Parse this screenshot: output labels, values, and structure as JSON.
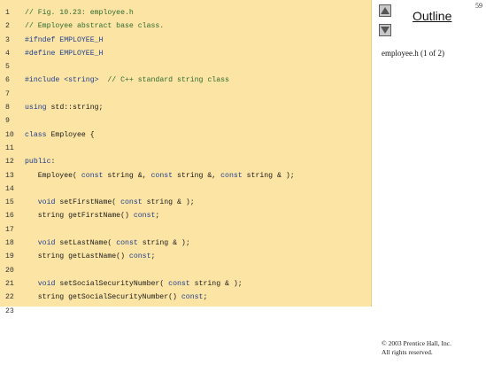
{
  "slide": {
    "number": "59"
  },
  "navigation": {
    "up_icon": "up-arrow-icon",
    "down_icon": "down-arrow-icon",
    "outline_label": "Outline",
    "file_caption": "employee.h (1 of 2)"
  },
  "footer": {
    "copyright_line1": "© 2003 Prentice Hall, Inc.",
    "copyright_line2": "All rights reserved."
  },
  "colors": {
    "code_background": "#fbe4a4",
    "comment": "#2f6b2f",
    "keyword": "#1f3f8f"
  },
  "code": {
    "lines": [
      {
        "num": "1",
        "tokens": [
          {
            "t": "// Fig. 10.23: employee.h",
            "k": "comment"
          }
        ]
      },
      {
        "num": "2",
        "tokens": [
          {
            "t": "// Employee abstract base class.",
            "k": "comment"
          }
        ]
      },
      {
        "num": "3",
        "tokens": [
          {
            "t": "#ifndef EMPLOYEE_H",
            "k": "preproc"
          }
        ]
      },
      {
        "num": "4",
        "tokens": [
          {
            "t": "#define EMPLOYEE_H",
            "k": "preproc"
          }
        ]
      },
      {
        "num": "5",
        "tokens": []
      },
      {
        "num": "6",
        "tokens": [
          {
            "t": "#include <string>",
            "k": "preproc"
          },
          {
            "t": "  // C++ standard string class",
            "k": "comment"
          }
        ]
      },
      {
        "num": "7",
        "tokens": []
      },
      {
        "num": "8",
        "tokens": [
          {
            "t": "using",
            "k": "keyword"
          },
          {
            "t": " std::string;",
            "k": "plain"
          }
        ]
      },
      {
        "num": "9",
        "tokens": []
      },
      {
        "num": "10",
        "tokens": [
          {
            "t": "class",
            "k": "keyword"
          },
          {
            "t": " Employee {",
            "k": "plain"
          }
        ]
      },
      {
        "num": "11",
        "tokens": []
      },
      {
        "num": "12",
        "tokens": [
          {
            "t": "public",
            "k": "keyword"
          },
          {
            "t": ":",
            "k": "plain"
          }
        ]
      },
      {
        "num": "13",
        "tokens": [
          {
            "t": "   Employee( ",
            "k": "plain"
          },
          {
            "t": "const",
            "k": "keyword"
          },
          {
            "t": " string &, ",
            "k": "plain"
          },
          {
            "t": "const",
            "k": "keyword"
          },
          {
            "t": " string &, ",
            "k": "plain"
          },
          {
            "t": "const",
            "k": "keyword"
          },
          {
            "t": " string & );",
            "k": "plain"
          }
        ]
      },
      {
        "num": "14",
        "tokens": []
      },
      {
        "num": "15",
        "tokens": [
          {
            "t": "   ",
            "k": "plain"
          },
          {
            "t": "void",
            "k": "keyword"
          },
          {
            "t": " setFirstName( ",
            "k": "plain"
          },
          {
            "t": "const",
            "k": "keyword"
          },
          {
            "t": " string & );",
            "k": "plain"
          }
        ]
      },
      {
        "num": "16",
        "tokens": [
          {
            "t": "   string getFirstName() ",
            "k": "plain"
          },
          {
            "t": "const",
            "k": "keyword"
          },
          {
            "t": ";",
            "k": "plain"
          }
        ]
      },
      {
        "num": "17",
        "tokens": []
      },
      {
        "num": "18",
        "tokens": [
          {
            "t": "   ",
            "k": "plain"
          },
          {
            "t": "void",
            "k": "keyword"
          },
          {
            "t": " setLastName( ",
            "k": "plain"
          },
          {
            "t": "const",
            "k": "keyword"
          },
          {
            "t": " string & );",
            "k": "plain"
          }
        ]
      },
      {
        "num": "19",
        "tokens": [
          {
            "t": "   string getLastName() ",
            "k": "plain"
          },
          {
            "t": "const",
            "k": "keyword"
          },
          {
            "t": ";",
            "k": "plain"
          }
        ]
      },
      {
        "num": "20",
        "tokens": []
      },
      {
        "num": "21",
        "tokens": [
          {
            "t": "   ",
            "k": "plain"
          },
          {
            "t": "void",
            "k": "keyword"
          },
          {
            "t": " setSocialSecurityNumber( ",
            "k": "plain"
          },
          {
            "t": "const",
            "k": "keyword"
          },
          {
            "t": " string & );",
            "k": "plain"
          }
        ]
      },
      {
        "num": "22",
        "tokens": [
          {
            "t": "   string getSocialSecurityNumber() ",
            "k": "plain"
          },
          {
            "t": "const",
            "k": "keyword"
          },
          {
            "t": ";",
            "k": "plain"
          }
        ]
      },
      {
        "num": "23",
        "tokens": []
      }
    ]
  }
}
